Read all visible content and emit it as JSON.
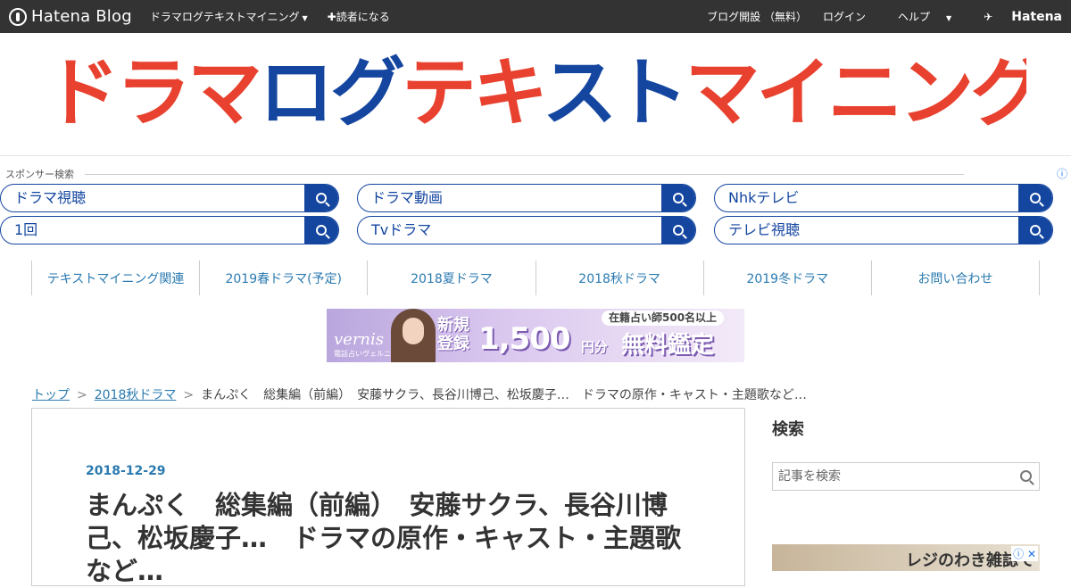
{
  "topbar": {
    "logo_text": "Hatena Blog",
    "blog_name": "ドラマログテキストマイニング",
    "subscribe": "✚読者になる",
    "open_blog": "ブログ開設 （無料）",
    "login": "ログイン",
    "help": "ヘルプ",
    "brand": "Hatena"
  },
  "banner": {
    "title_parts": [
      "ドラマ",
      "ログ",
      "テキ",
      "スト",
      "マイニング"
    ]
  },
  "sponsor": {
    "label": "スポンサー検索",
    "searches": [
      "ドラマ視聴",
      "ドラマ動画",
      "Nhkテレビ",
      "1回",
      "Tvドラマ",
      "テレビ視聴"
    ]
  },
  "nav": {
    "items": [
      "テキストマイニング関連",
      "2019春ドラマ(予定)",
      "2018夏ドラマ",
      "2018秋ドラマ",
      "2019冬ドラマ",
      "お問い合わせ"
    ]
  },
  "ad": {
    "brand": "vernis",
    "brand_sub": "電話占いヴェルニ",
    "badge": "在籍占い師500名以上",
    "new": "新規",
    "register": "登録",
    "amount": "1,500",
    "unit": "円分",
    "free": "無料鑑定"
  },
  "breadcrumb": {
    "top": "トップ",
    "category": "2018秋ドラマ",
    "sep": ">",
    "current": "まんぷく　総集編（前編）　安藤サクラ、長谷川博己、松坂慶子…　ドラマの原作・キャスト・主題歌など…"
  },
  "article": {
    "date": "2018-12-29",
    "title": "まんぷく　総集編（前編）　安藤サクラ、長谷川博己、松坂慶子…　ドラマの原作・キャスト・主題歌など…"
  },
  "sidebar": {
    "title": "検索",
    "search_placeholder": "記事を検索",
    "ad_text": "レジのわき雑誌で"
  },
  "colors": {
    "topbar_bg": "#333333",
    "accent_blue": "#1446a0",
    "accent_red": "#e8412f",
    "link": "#2a7ab0"
  }
}
